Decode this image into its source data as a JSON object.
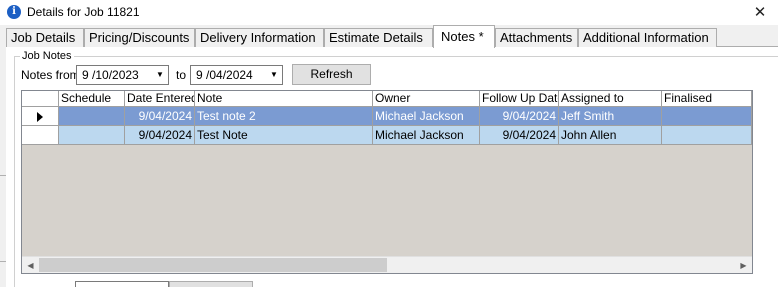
{
  "window": {
    "title": "Details for Job 11821",
    "icon": "info-icon",
    "close_glyph": "✕"
  },
  "tabs": [
    {
      "label": "Job Details",
      "active": false
    },
    {
      "label": "Pricing/Discounts",
      "active": false
    },
    {
      "label": "Delivery Information",
      "active": false
    },
    {
      "label": "Estimate Details",
      "active": false
    },
    {
      "label": "Notes *",
      "active": true
    },
    {
      "label": "Attachments",
      "active": false
    },
    {
      "label": "Additional Information",
      "active": false
    }
  ],
  "job_notes": {
    "group_title": "Job Notes",
    "notes_from_label": "Notes from",
    "from_date": "9 /10/2023",
    "to_label": "to",
    "to_date": "9 /04/2024",
    "refresh_label": "Refresh"
  },
  "grid": {
    "columns": [
      "Schedule",
      "Date Entered",
      "Note",
      "Owner",
      "Follow Up Date",
      "Assigned to",
      "Finalised"
    ],
    "rows": [
      {
        "schedule": "",
        "date_entered": "9/04/2024",
        "note": "Test note 2",
        "owner": "Michael Jackson",
        "follow_up": "9/04/2024",
        "assigned_to": "Jeff Smith",
        "finalised": "",
        "selected": true
      },
      {
        "schedule": "",
        "date_entered": "9/04/2024",
        "note": "Test Note",
        "owner": "Michael Jackson",
        "follow_up": "9/04/2024",
        "assigned_to": "John Allen",
        "finalised": "",
        "selected": false
      }
    ]
  },
  "colors": {
    "selected_row": "#7b9bd2",
    "alt_row": "#bcd8ef",
    "grid_background": "#d6d2cc"
  }
}
